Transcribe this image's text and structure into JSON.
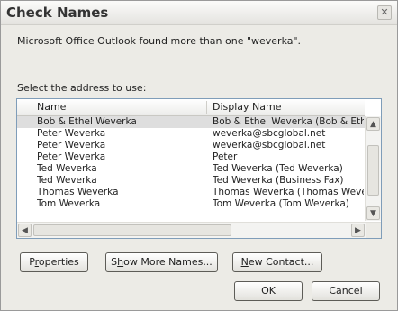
{
  "window": {
    "title": "Check Names"
  },
  "message": "Microsoft Office Outlook found more than one \"weverka\".",
  "select_label": "Select the address to use:",
  "columns": {
    "name": "Name",
    "display": "Display Name"
  },
  "rows": [
    {
      "name": "Bob & Ethel Weverka",
      "display": "Bob & Ethel Weverka (Bob & Ethel"
    },
    {
      "name": "Peter Weverka",
      "display": "weverka@sbcglobal.net"
    },
    {
      "name": "Peter Weverka",
      "display": "weverka@sbcglobal.net"
    },
    {
      "name": "Peter Weverka",
      "display": "Peter"
    },
    {
      "name": "Ted Weverka",
      "display": "Ted Weverka (Ted Weverka)"
    },
    {
      "name": "Ted Weverka",
      "display": "Ted Weverka (Business Fax)"
    },
    {
      "name": "Thomas Weverka",
      "display": "Thomas Weverka (Thomas Weve"
    },
    {
      "name": "Tom Weverka",
      "display": "Tom Weverka (Tom Weverka)"
    }
  ],
  "buttons": {
    "properties_first": "P",
    "properties_u": "r",
    "properties_rest": "operties",
    "show_more_first": "S",
    "show_more_u": "h",
    "show_more_rest": "ow More Names...",
    "new_contact_u": "N",
    "new_contact_rest": "ew Contact...",
    "ok": "OK",
    "cancel": "Cancel"
  },
  "icons": {
    "close": "close-icon",
    "scroll_up": "arrow-up-icon",
    "scroll_down": "arrow-down-icon",
    "scroll_left": "arrow-left-icon",
    "scroll_right": "arrow-right-icon"
  }
}
